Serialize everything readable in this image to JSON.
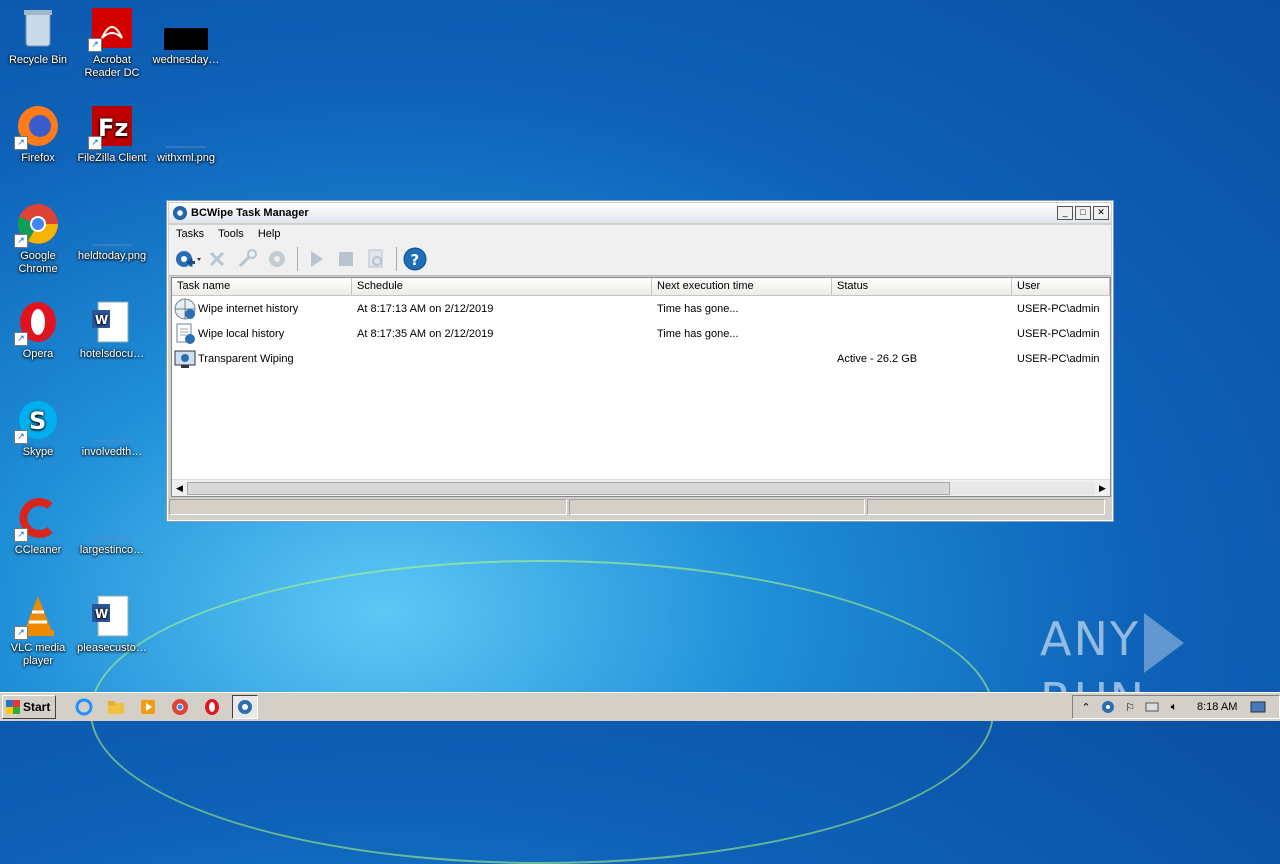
{
  "desktop": {
    "icons": [
      {
        "label": "Recycle Bin"
      },
      {
        "label": "Acrobat Reader DC"
      },
      {
        "label": "wednesday…"
      },
      {
        "label": "Firefox"
      },
      {
        "label": "FileZilla Client"
      },
      {
        "label": "withxml.png"
      },
      {
        "label": "Google Chrome"
      },
      {
        "label": "heldtoday.png"
      },
      {
        "label": "Opera"
      },
      {
        "label": "hotelsdocu…"
      },
      {
        "label": "Skype"
      },
      {
        "label": "involvedth…"
      },
      {
        "label": "CCleaner"
      },
      {
        "label": "largestinco…"
      },
      {
        "label": "VLC media player"
      },
      {
        "label": "pleasecusto…"
      }
    ],
    "watermark": "ANY RUN"
  },
  "window": {
    "title": "BCWipe Task Manager",
    "menu": [
      "Tasks",
      "Tools",
      "Help"
    ],
    "columns": [
      "Task name",
      "Schedule",
      "Next execution time",
      "Status",
      "User"
    ],
    "rows": [
      {
        "name": "Wipe internet history",
        "schedule": "At 8:17:13 AM on 2/12/2019",
        "next": "Time has gone...",
        "status": "",
        "user": "USER-PC\\admin"
      },
      {
        "name": "Wipe local history",
        "schedule": "At 8:17:35 AM on 2/12/2019",
        "next": "Time has gone...",
        "status": "",
        "user": "USER-PC\\admin"
      },
      {
        "name": "Transparent Wiping",
        "schedule": "",
        "next": "",
        "status": "Active - 26.2 GB",
        "user": "USER-PC\\admin"
      }
    ]
  },
  "taskbar": {
    "start_label": "Start",
    "clock": "8:18 AM"
  },
  "colors": {
    "accent": "#1f6fb8",
    "desktop": "#0e62b8"
  }
}
